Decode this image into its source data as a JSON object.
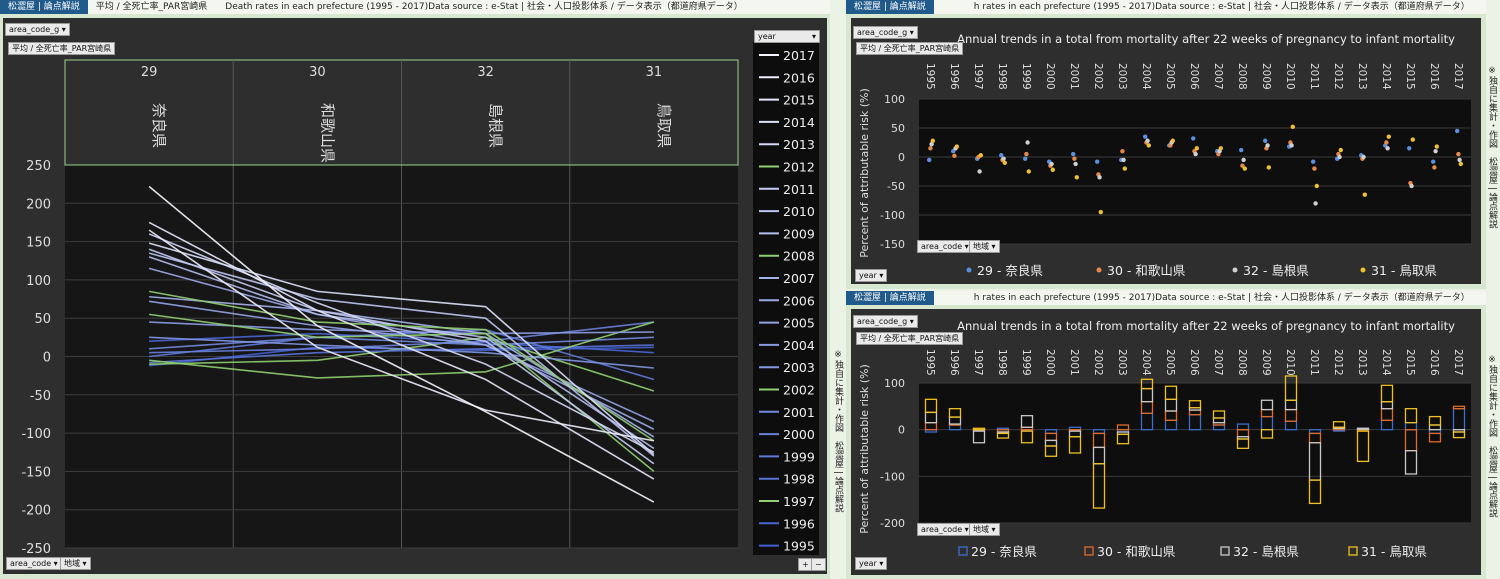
{
  "colors": {
    "bg": "#2e2e2e",
    "plot": "#101010",
    "accent": "#1f5a8b",
    "grid": "#555555",
    "frame": "#9bd28a"
  },
  "left": {
    "brand": "松澀屋 | 論点解説",
    "header_text": "平均 / 全死亡率_PAR宮崎県　　Death rates in each prefecture (1995 - 2017)Data source : e-Stat | 社会・人口投影体系 / データ表示（都道府県データ）",
    "filter_btn": "area_code_g",
    "subtitle": "平均 / 全死亡率_PAR宮崎県",
    "legend_header": "year",
    "bottom_btn1": "area_code",
    "bottom_btn2": "地域",
    "plus": "+",
    "minus": "−",
    "side_note": "※独自に集計・作図　松澀屋 | 論点解説"
  },
  "tr": {
    "brand": "松澀屋 | 論点解説",
    "header_text": "h rates in each prefecture (1995 - 2017)Data source : e-Stat | 社会・人口投影体系 / データ表示（都道府県データ）",
    "filter_btn": "area_code_g",
    "subtitle": "平均 / 全死亡率_PAR宮崎県",
    "btn1": "area_code",
    "btn2": "地域",
    "year_btn": "year",
    "side_note": "※独自に集計・作図　松澀屋 | 論点解説"
  },
  "br": {
    "brand": "松澀屋 | 論点解説",
    "header_text": "h rates in each prefecture (1995 - 2017)Data source : e-Stat | 社会・人口投影体系 / データ表示（都道府県データ）",
    "filter_btn": "area_code_g",
    "subtitle": "平均 / 全死亡率_PAR宮崎県",
    "btn1": "area_code",
    "btn2": "地域",
    "year_btn": "year",
    "side_note": "※独自に集計・作図　松澀屋 | 論点解説"
  },
  "chart_data": [
    {
      "type": "line",
      "title": "",
      "categories": [
        {
          "code": "29",
          "name": "奈良県"
        },
        {
          "code": "30",
          "name": "和歌山県"
        },
        {
          "code": "32",
          "name": "島根県"
        },
        {
          "code": "31",
          "name": "鳥取県"
        }
      ],
      "ylim": [
        -250,
        250
      ],
      "yticks": [
        250,
        200,
        150,
        100,
        50,
        0,
        -50,
        -100,
        -150,
        -200,
        -250
      ],
      "series": [
        {
          "name": "2017",
          "values": [
            222,
            40,
            -72,
            -190
          ]
        },
        {
          "name": "2016",
          "values": [
            165,
            12,
            -70,
            -110
          ]
        },
        {
          "name": "2015",
          "values": [
            175,
            60,
            -30,
            -160
          ]
        },
        {
          "name": "2014",
          "values": [
            148,
            85,
            65,
            -128
          ]
        },
        {
          "name": "2013",
          "values": [
            160,
            70,
            -10,
            -125
          ]
        },
        {
          "name": "2012",
          "values": [
            85,
            45,
            35,
            -110
          ]
        },
        {
          "name": "2011",
          "values": [
            140,
            60,
            20,
            -140
          ]
        },
        {
          "name": "2010",
          "values": [
            135,
            75,
            50,
            -130
          ]
        },
        {
          "name": "2009",
          "values": [
            130,
            55,
            25,
            -120
          ]
        },
        {
          "name": "2008",
          "values": [
            55,
            25,
            30,
            -150
          ]
        },
        {
          "name": "2007",
          "values": [
            78,
            60,
            30,
            -105
          ]
        },
        {
          "name": "2006",
          "values": [
            115,
            55,
            15,
            -95
          ]
        },
        {
          "name": "2005",
          "values": [
            72,
            40,
            15,
            -85
          ]
        },
        {
          "name": "2004",
          "values": [
            45,
            35,
            30,
            32
          ]
        },
        {
          "name": "2003",
          "values": [
            25,
            15,
            5,
            -15
          ]
        },
        {
          "name": "2002",
          "values": [
            -5,
            -28,
            -20,
            45
          ]
        },
        {
          "name": "2001",
          "values": [
            10,
            25,
            15,
            25
          ]
        },
        {
          "name": "2000",
          "values": [
            5,
            10,
            20,
            45
          ]
        },
        {
          "name": "1999",
          "values": [
            0,
            25,
            35,
            -30
          ]
        },
        {
          "name": "1998",
          "values": [
            -8,
            5,
            10,
            15
          ]
        },
        {
          "name": "1997",
          "values": [
            -10,
            -5,
            25,
            -45
          ]
        },
        {
          "name": "1996",
          "values": [
            20,
            30,
            18,
            5
          ]
        },
        {
          "name": "1995",
          "values": [
            -12,
            12,
            8,
            12
          ]
        }
      ]
    },
    {
      "type": "scatter",
      "title": "Annual trends in a total from mortality after 22 weeks of pregnancy to infant mortality",
      "ylabel": "Percent of attributable risk (%)",
      "ylim": [
        -150,
        100
      ],
      "yticks": [
        100,
        50,
        0,
        -50,
        -100,
        -150
      ],
      "years": [
        "1995",
        "1996",
        "1997",
        "1998",
        "1999",
        "2000",
        "2001",
        "2002",
        "2003",
        "2004",
        "2005",
        "2006",
        "2007",
        "2008",
        "2009",
        "2010",
        "2011",
        "2012",
        "2013",
        "2014",
        "2015",
        "2016",
        "2017"
      ],
      "series": [
        {
          "name": "29 - 奈良県",
          "color": "#5b8fe0",
          "values": [
            -5,
            10,
            -3,
            3,
            -3,
            -8,
            5,
            -8,
            -5,
            35,
            20,
            32,
            10,
            12,
            28,
            18,
            -8,
            -3,
            3,
            20,
            15,
            -8,
            45
          ]
        },
        {
          "name": "30 - 和歌山県",
          "color": "#e8894a",
          "values": [
            15,
            2,
            0,
            -5,
            5,
            -15,
            -3,
            -30,
            10,
            25,
            20,
            10,
            5,
            -15,
            15,
            25,
            -20,
            5,
            -3,
            25,
            -45,
            -18,
            5
          ]
        },
        {
          "name": "32 - 島根県",
          "color": "#d0d0d0",
          "values": [
            22,
            15,
            -25,
            -3,
            25,
            -12,
            -12,
            -35,
            -5,
            28,
            25,
            5,
            10,
            -5,
            20,
            20,
            -80,
            0,
            0,
            15,
            -50,
            10,
            -5
          ]
        },
        {
          "name": "31 - 鳥取県",
          "color": "#f0c030",
          "values": [
            28,
            18,
            3,
            -10,
            -25,
            -22,
            -35,
            -95,
            -20,
            20,
            28,
            15,
            15,
            -20,
            -18,
            52,
            -50,
            12,
            -65,
            35,
            30,
            18,
            -12
          ]
        }
      ]
    },
    {
      "type": "bar",
      "title": "Annual trends in a total from mortality after 22 weeks of pregnancy to infant mortality",
      "ylabel": "Percent of attributable risk (%)",
      "ylim": [
        -200,
        100
      ],
      "yticks": [
        100,
        0,
        -100,
        -200
      ],
      "years": [
        "1995",
        "1996",
        "1997",
        "1998",
        "1999",
        "2000",
        "2001",
        "2002",
        "2003",
        "2004",
        "2005",
        "2006",
        "2007",
        "2008",
        "2009",
        "2010",
        "2011",
        "2012",
        "2013",
        "2014",
        "2015",
        "2016",
        "2017"
      ],
      "series": [
        {
          "name": "29 - 奈良県",
          "color": "#3a6fd0",
          "values": [
            -5,
            10,
            -3,
            3,
            -3,
            -8,
            5,
            -8,
            -5,
            35,
            20,
            32,
            10,
            12,
            28,
            18,
            -8,
            -3,
            3,
            20,
            15,
            -8,
            45
          ]
        },
        {
          "name": "30 - 和歌山県",
          "color": "#e06a2a",
          "values": [
            15,
            2,
            0,
            -5,
            5,
            -15,
            -3,
            -30,
            10,
            25,
            20,
            10,
            5,
            -15,
            15,
            25,
            -20,
            5,
            -3,
            25,
            -45,
            -18,
            5
          ]
        },
        {
          "name": "32 - 島根県",
          "color": "#c8c8c8",
          "values": [
            22,
            15,
            -25,
            -3,
            25,
            -12,
            -12,
            -35,
            -5,
            28,
            25,
            5,
            10,
            -5,
            20,
            20,
            -80,
            0,
            0,
            15,
            -50,
            10,
            -5
          ]
        },
        {
          "name": "31 - 鳥取県",
          "color": "#f0c020",
          "values": [
            28,
            18,
            3,
            -10,
            -25,
            -22,
            -35,
            -95,
            -20,
            20,
            28,
            15,
            15,
            -20,
            -18,
            52,
            -50,
            12,
            -65,
            35,
            30,
            18,
            -12
          ]
        }
      ]
    }
  ]
}
